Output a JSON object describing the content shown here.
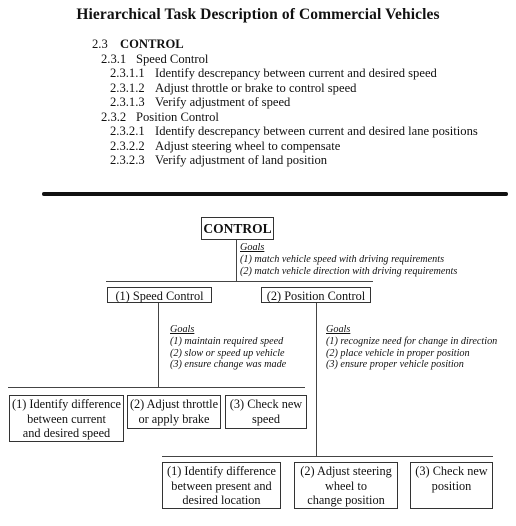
{
  "title": "Hierarchical Task Description of Commercial Vehicles",
  "outline": [
    {
      "num": "2.3",
      "text": "CONTROL",
      "level": 1
    },
    {
      "num": "2.3.1",
      "text": "Speed Control",
      "level": 2
    },
    {
      "num": "2.3.1.1",
      "text": "Identify descrepancy between current and desired speed",
      "level": 3
    },
    {
      "num": "2.3.1.2",
      "text": "Adjust throttle or brake to control speed",
      "level": 3
    },
    {
      "num": "2.3.1.3",
      "text": "Verify adjustment of speed",
      "level": 3
    },
    {
      "num": "2.3.2",
      "text": "Position Control",
      "level": 2
    },
    {
      "num": "2.3.2.1",
      "text": "Identify descrepancy between current and desired lane positions",
      "level": 3
    },
    {
      "num": "2.3.2.2",
      "text": "Adjust steering wheel to compensate",
      "level": 3
    },
    {
      "num": "2.3.2.3",
      "text": "Verify adjustment of land position",
      "level": 3
    }
  ],
  "diagram": {
    "root": {
      "label": "CONTROL",
      "goals_heading": "Goals",
      "goals": [
        "(1) match vehicle speed with driving requirements",
        "(2) match vehicle direction with driving requirements"
      ]
    },
    "speed": {
      "label": "(1) Speed Control",
      "goals_heading": "Goals",
      "goals": [
        "(1) maintain required speed",
        "(2) slow or speed up vehicle",
        "(3) ensure change was made"
      ],
      "subtasks": [
        "(1) Identify difference\nbetween current\nand desired speed",
        "(2) Adjust throttle\nor apply brake",
        "(3) Check new\nspeed"
      ]
    },
    "position": {
      "label": "(2) Position Control",
      "goals_heading": "Goals",
      "goals": [
        "(1) recognize need for change in direction",
        "(2) place vehicle in proper position",
        "(3) ensure proper vehicle position"
      ],
      "subtasks": [
        "(1) Identify difference\nbetween present and\ndesired location",
        "(2) Adjust steering\nwheel to\nchange position",
        "(3) Check new\nposition"
      ]
    }
  }
}
